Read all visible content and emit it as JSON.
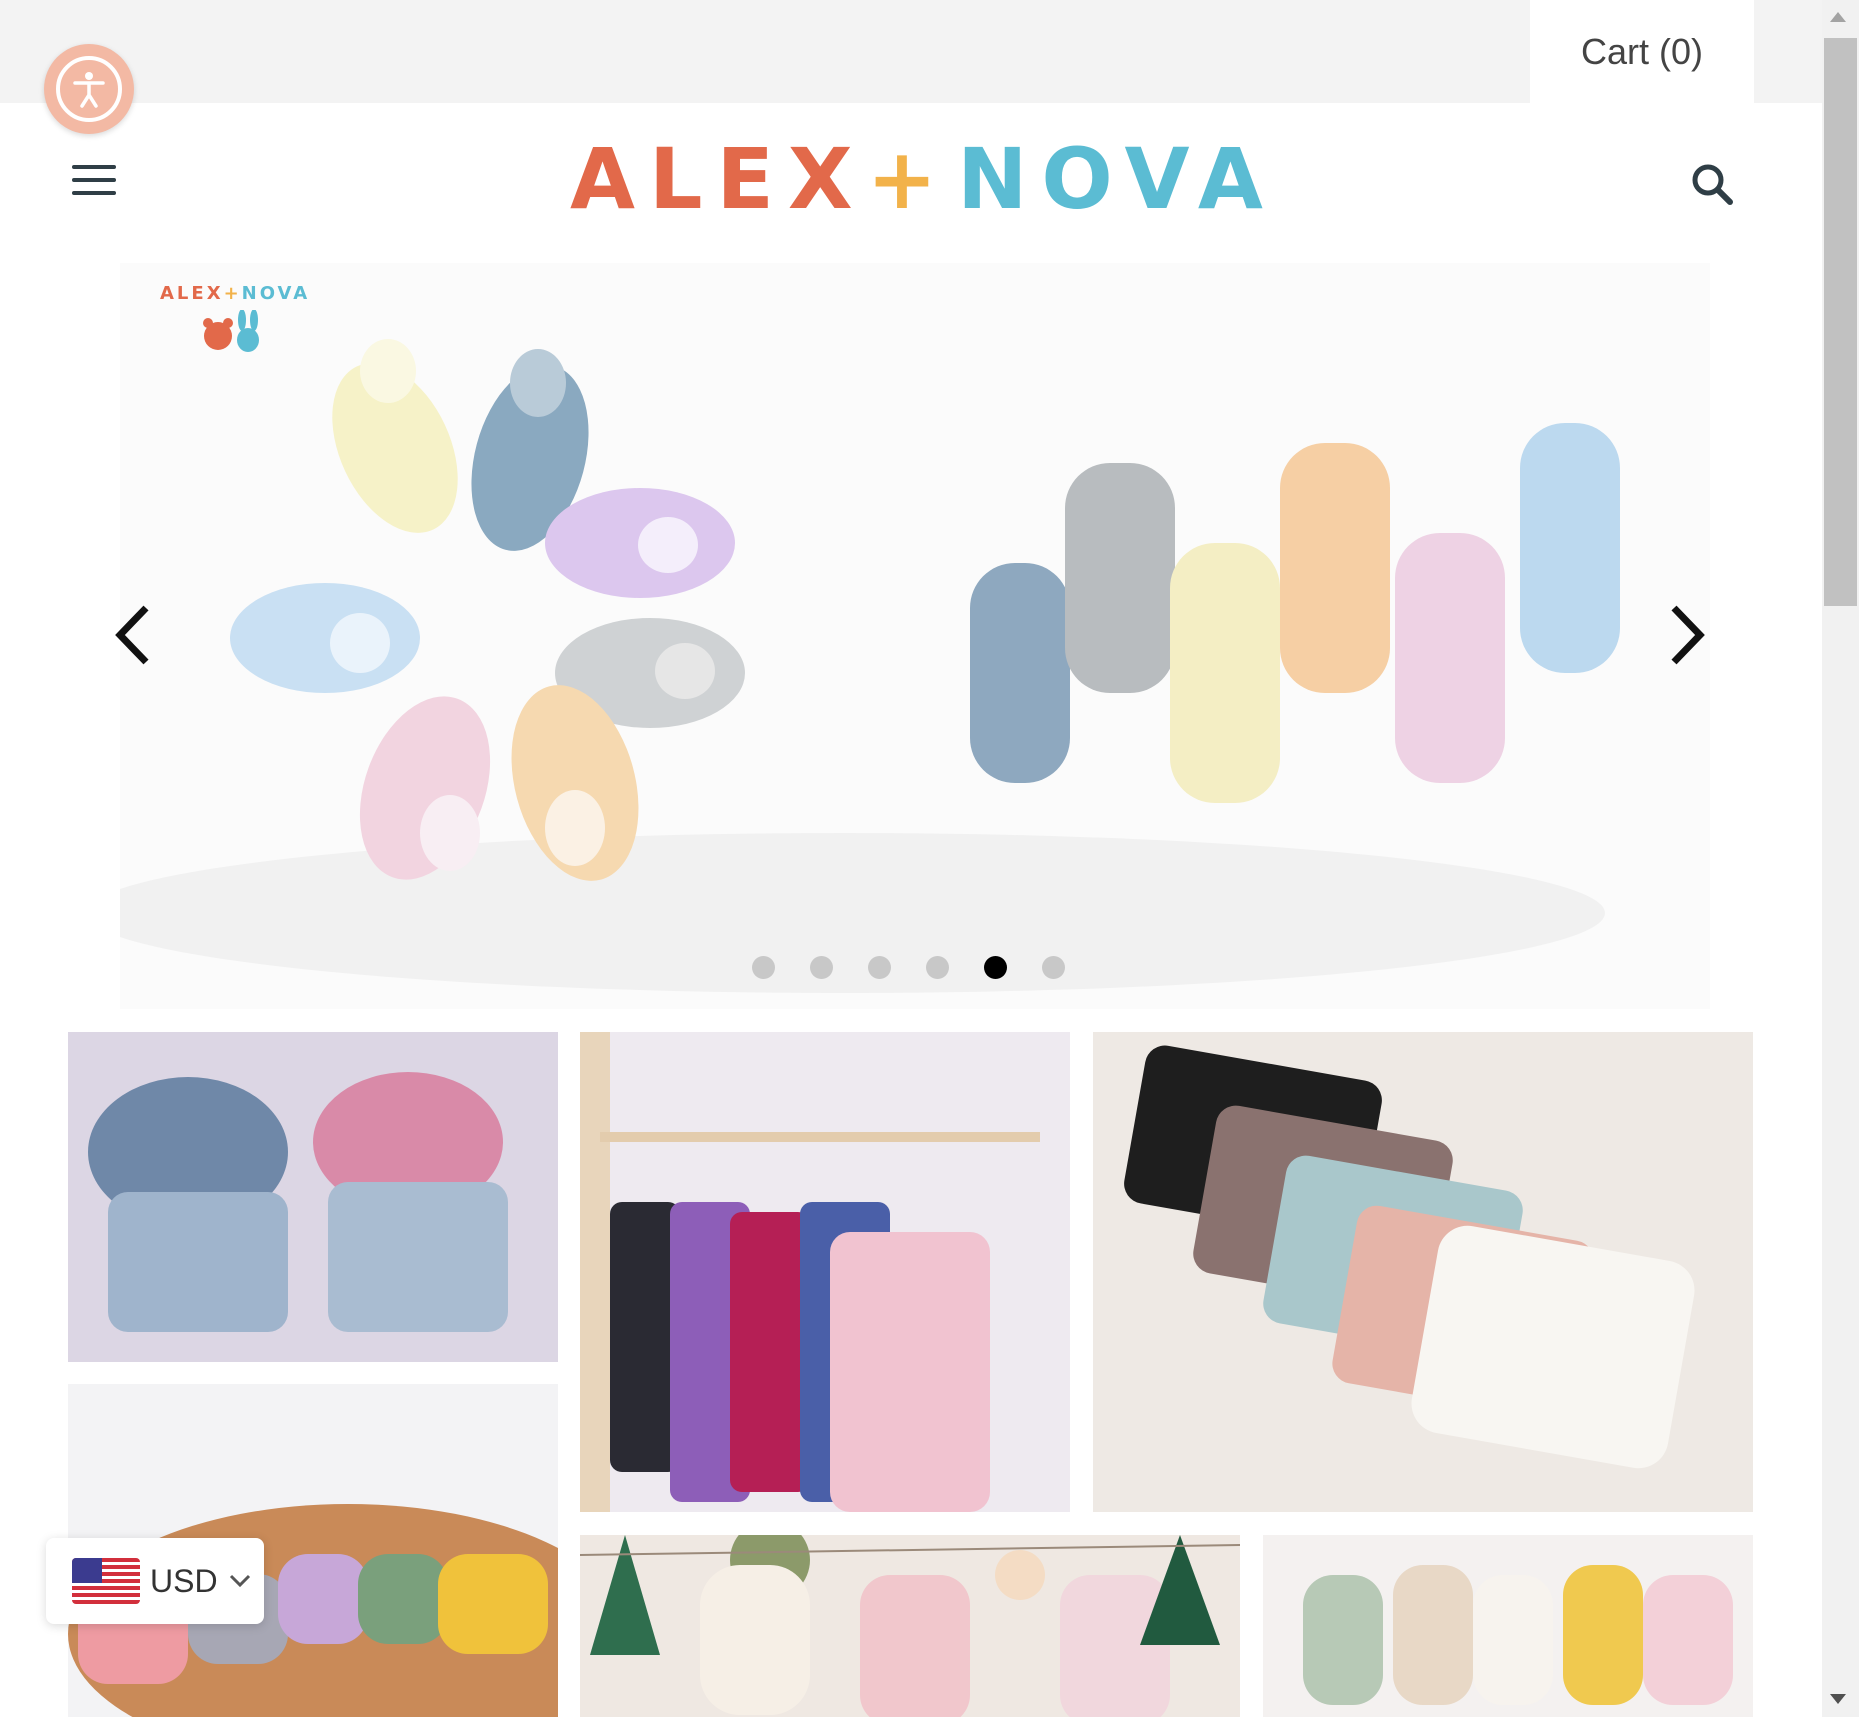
{
  "header": {
    "cart_label": "Cart (0)",
    "logo_left": "ALEX",
    "logo_plus": "+",
    "logo_right": "NOVA"
  },
  "slider": {
    "mini_logo_left": "ALEX",
    "mini_logo_plus": "+",
    "mini_logo_right": "NOVA",
    "slide_count": 6,
    "active_slide": 5
  },
  "currency": {
    "code": "USD"
  },
  "colors": {
    "logo_orange": "#e2694a",
    "logo_yellow": "#f2b24a",
    "logo_blue": "#5bbcd3",
    "accessibility_button": "#f3b9a4",
    "topbar_bg": "#f3f3f3"
  },
  "icons": [
    "accessibility-icon",
    "menu-icon",
    "search-icon",
    "chevron-left-icon",
    "chevron-right-icon",
    "chevron-down-icon",
    "us-flag-icon"
  ]
}
